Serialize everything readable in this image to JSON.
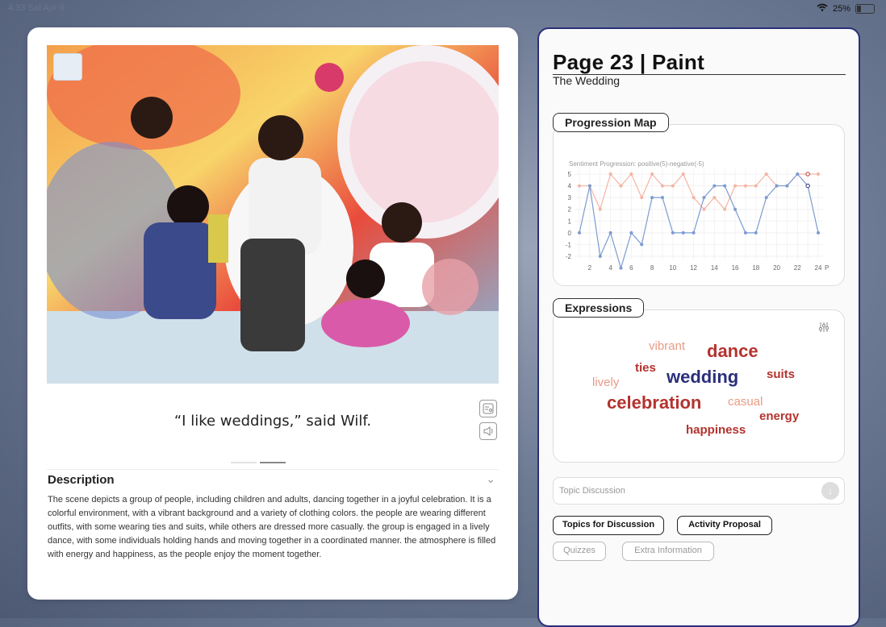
{
  "status": {
    "time": "4:33",
    "date": "Sat Apr 9",
    "battery": "25%"
  },
  "caption": "“I like weddings,” said Wilf.",
  "description": {
    "title": "Description",
    "text": " The scene depicts a group of people, including children and adults, dancing together in a joyful celebration.  It is a colorful environment, with a vibrant background and a variety of clothing colors. the people are wearing different outfits, with some wearing ties and suits, while others are dressed more casually.  the group is engaged in a lively dance, with some individuals holding hands and moving together in a coordinated manner. the atmosphere is filled with energy and happiness, as the people enjoy the moment together."
  },
  "panel": {
    "title": "Page 23 | Paint",
    "subtitle": "The Wedding",
    "progression_label": "Progression Map",
    "expressions_label": "Expressions",
    "topic_placeholder": "Topic Discussion",
    "buttons": {
      "topics": "Topics for Discussion",
      "activity": "Activity Proposal",
      "quizzes": "Quizzes",
      "extra": "Extra Information"
    }
  },
  "chart_data": {
    "type": "line",
    "title": "Sentiment Progression: positive(5)-negative(-5)",
    "xlabel": "P",
    "ylim": [
      -2,
      5
    ],
    "yticks": [
      -2,
      -1,
      0,
      1,
      2,
      3,
      4,
      5
    ],
    "xticks": [
      2,
      4,
      6,
      8,
      10,
      12,
      14,
      16,
      18,
      20,
      22,
      24
    ],
    "x": [
      1,
      2,
      3,
      4,
      5,
      6,
      7,
      8,
      9,
      10,
      11,
      12,
      13,
      14,
      15,
      16,
      17,
      18,
      19,
      20,
      21,
      22,
      23,
      24
    ],
    "series": [
      {
        "color": "#f4b4a4",
        "values": [
          4,
          4,
          2,
          5,
          4,
          5,
          3,
          5,
          4,
          4,
          5,
          3,
          2,
          3,
          2,
          4,
          4,
          4,
          5,
          4,
          4,
          5,
          5,
          5
        ]
      },
      {
        "color": "#7c9bd0",
        "values": [
          0,
          4,
          -2,
          0,
          -3,
          0,
          -1,
          3,
          3,
          0,
          0,
          0,
          3,
          4,
          4,
          2,
          0,
          0,
          3,
          4,
          4,
          5,
          4,
          0
        ]
      }
    ],
    "grid": true
  },
  "word_cloud": [
    {
      "text": "vibrant",
      "size": 15,
      "color": "#e89b84",
      "weight": "normal"
    },
    {
      "text": "dance",
      "size": 22,
      "color": "#b3332f",
      "weight": "bold"
    },
    {
      "text": "ties",
      "size": 15,
      "color": "#b3332f",
      "weight": "bold"
    },
    {
      "text": "suits",
      "size": 15,
      "color": "#b3332f",
      "weight": "bold"
    },
    {
      "text": "lively",
      "size": 15,
      "color": "#e89b84",
      "weight": "normal"
    },
    {
      "text": "wedding",
      "size": 22,
      "color": "#2a2f7a",
      "weight": "bold"
    },
    {
      "text": "celebration",
      "size": 22,
      "color": "#b3332f",
      "weight": "bold"
    },
    {
      "text": "casual",
      "size": 15,
      "color": "#e89b84",
      "weight": "normal"
    },
    {
      "text": "energy",
      "size": 15,
      "color": "#b3332f",
      "weight": "bold"
    },
    {
      "text": "happiness",
      "size": 15,
      "color": "#b3332f",
      "weight": "bold"
    }
  ]
}
